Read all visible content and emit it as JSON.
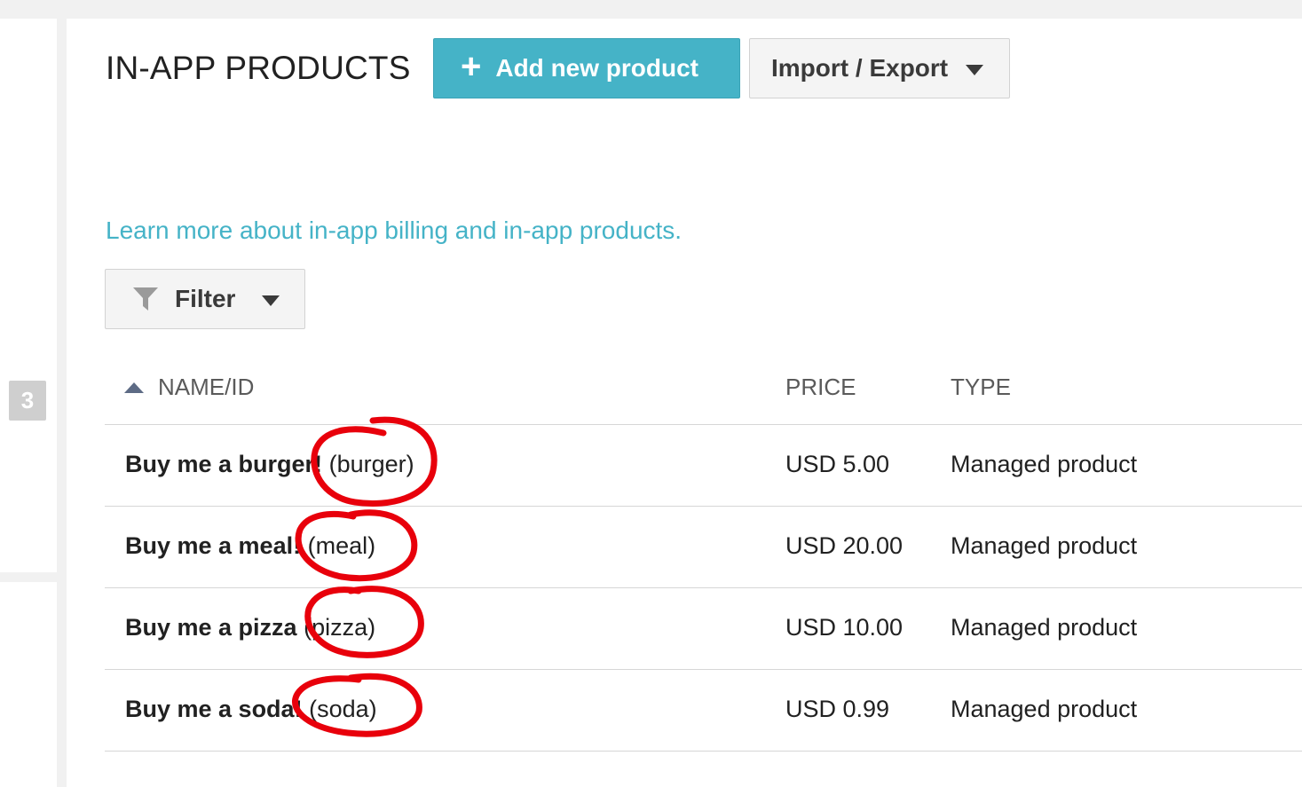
{
  "page": {
    "title": "IN-APP PRODUCTS",
    "add_button_label": "Add new product",
    "import_export_label": "Import / Export",
    "learn_more_link": "Learn more about in-app billing and in-app products.",
    "filter_label": "Filter",
    "step_number": "3"
  },
  "table": {
    "columns": [
      "NAME/ID",
      "PRICE",
      "TYPE"
    ],
    "sort": "NAME/ID ascending",
    "rows": [
      {
        "name": "Buy me a burger!",
        "id": "(burger)",
        "price": "USD 5.00",
        "type": "Managed product"
      },
      {
        "name": "Buy me a meal!",
        "id": "(meal)",
        "price": "USD 20.00",
        "type": "Managed product"
      },
      {
        "name": "Buy me a pizza",
        "id": "(pizza)",
        "price": "USD 10.00",
        "type": "Managed product"
      },
      {
        "name": "Buy me a soda!",
        "id": "(soda)",
        "price": "USD 0.99",
        "type": "Managed product"
      }
    ]
  },
  "colors": {
    "accent": "#45b3c7",
    "annotation": "#e8000b"
  },
  "icons": [
    "plus-icon",
    "chevron-down-icon",
    "filter-funnel-icon",
    "sort-ascending-icon"
  ]
}
